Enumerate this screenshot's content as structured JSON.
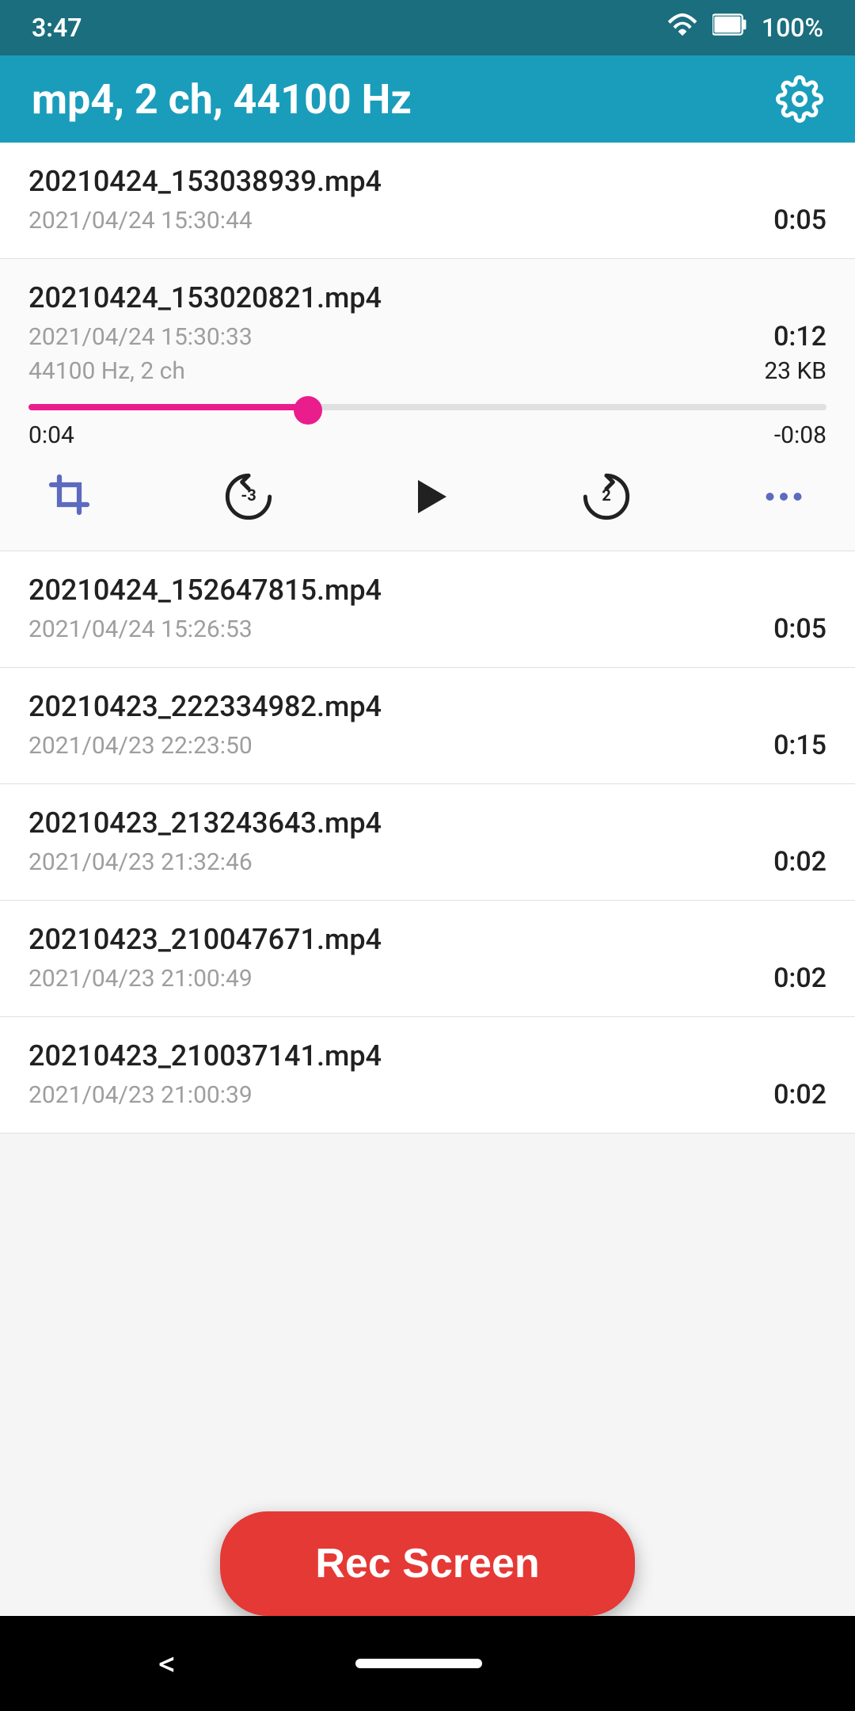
{
  "status_bar": {
    "time": "3:47",
    "battery": "100%"
  },
  "header": {
    "title": "mp4, 2 ch, 44100 Hz",
    "settings_label": "settings"
  },
  "recordings": [
    {
      "id": 1,
      "filename": "20210424_153038939.mp4",
      "date": "2021/04/24 15:30:44",
      "duration": "0:05",
      "size": null,
      "hz": null,
      "expanded": false
    },
    {
      "id": 2,
      "filename": "20210424_153020821.mp4",
      "date": "2021/04/24 15:30:33",
      "duration": "0:12",
      "size": "23 KB",
      "hz": "44100 Hz, 2 ch",
      "expanded": true,
      "slider_current": "0:04",
      "slider_remaining": "-0:08",
      "slider_percent": 35
    },
    {
      "id": 3,
      "filename": "20210424_152647815.mp4",
      "date": "2021/04/24 15:26:53",
      "duration": "0:05",
      "size": null,
      "hz": null,
      "expanded": false
    },
    {
      "id": 4,
      "filename": "20210423_222334982.mp4",
      "date": "2021/04/23 22:23:50",
      "duration": "0:15",
      "size": null,
      "hz": null,
      "expanded": false
    },
    {
      "id": 5,
      "filename": "20210423_213243643.mp4",
      "date": "2021/04/23 21:32:46",
      "duration": "0:02",
      "size": null,
      "hz": null,
      "expanded": false
    },
    {
      "id": 6,
      "filename": "20210423_210047671.mp4",
      "date": "2021/04/23 21:00:49",
      "duration": "0:02",
      "size": null,
      "hz": null,
      "expanded": false
    },
    {
      "id": 7,
      "filename": "20210423_210037141.mp4",
      "date": "2021/04/23 21:00:39",
      "duration": "0:02",
      "size": null,
      "hz": null,
      "expanded": false
    }
  ],
  "controls": {
    "rewind_label": "-3",
    "forward_label": "2",
    "play_label": "play"
  },
  "rec_screen_button": "Rec Screen",
  "nav": {
    "back_label": "<"
  }
}
